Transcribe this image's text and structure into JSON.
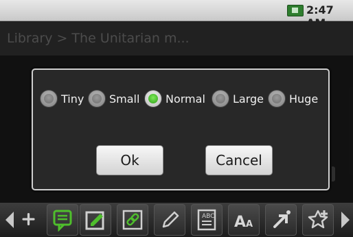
{
  "status_bar": {
    "time": "2:47 AM",
    "battery_icon": "battery-icon"
  },
  "title_bar": {
    "breadcrumb": "Library > The Unitarian m..."
  },
  "dialog": {
    "options": [
      {
        "label": "Tiny",
        "selected": false
      },
      {
        "label": "Small",
        "selected": false
      },
      {
        "label": "Normal",
        "selected": true
      },
      {
        "label": "Large",
        "selected": false
      },
      {
        "label": "Huge",
        "selected": false
      }
    ],
    "ok_label": "Ok",
    "cancel_label": "Cancel"
  },
  "toolbar": {
    "icons": [
      "add-icon",
      "comment-icon",
      "edit-note-icon",
      "link-icon",
      "pencil-icon",
      "spellcheck-icon",
      "font-size-icon",
      "go-to-icon",
      "add-bookmark-icon"
    ],
    "text_icon_labels": {
      "spellcheck": "ABC",
      "font_big": "A",
      "font_small": "A"
    }
  },
  "colors": {
    "selected_radio": "#2c9f16",
    "accent_green": "#4fbf2c"
  }
}
